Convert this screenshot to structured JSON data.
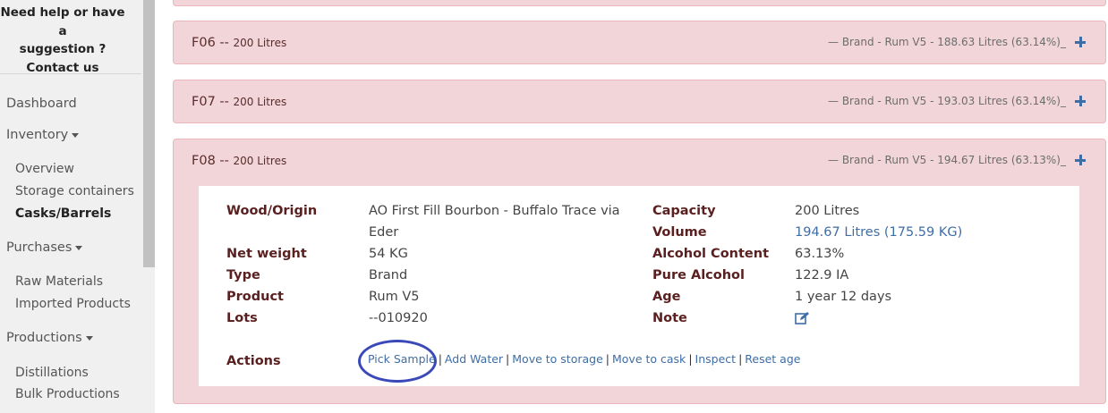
{
  "sidebar": {
    "help_line1": "Need help or have a",
    "help_line2": "suggestion ?",
    "contact": "Contact us",
    "items": [
      {
        "label": "Dashboard"
      },
      {
        "label": "Inventory"
      },
      {
        "label": "Overview"
      },
      {
        "label": "Storage containers"
      },
      {
        "label": "Casks/Barrels"
      },
      {
        "label": "Purchases"
      },
      {
        "label": "Raw Materials"
      },
      {
        "label": "Imported Products"
      },
      {
        "label": "Productions"
      },
      {
        "label": "Distillations"
      },
      {
        "label": "Bulk Productions"
      }
    ]
  },
  "casks": [
    {
      "id": "F06",
      "sep": "-- ",
      "capacity": "200 Litres",
      "summary": "—  Brand - Rum V5 - 188.63 Litres (63.14%)_"
    },
    {
      "id": "F07",
      "sep": "-- ",
      "capacity": "200 Litres",
      "summary": "—  Brand - Rum V5 - 193.03 Litres (63.14%)_"
    },
    {
      "id": "F08",
      "sep": "-- ",
      "capacity": "200 Litres",
      "summary": "—  Brand - Rum V5 - 194.67 Litres (63.13%)_"
    }
  ],
  "detail": {
    "labels": {
      "wood": "Wood/Origin",
      "net_weight": "Net weight",
      "type": "Type",
      "product": "Product",
      "lots": "Lots",
      "capacity": "Capacity",
      "volume": "Volume",
      "alcohol": "Alcohol Content",
      "pure_alcohol": "Pure Alcohol",
      "age": "Age",
      "note": "Note",
      "actions": "Actions"
    },
    "values": {
      "wood_line1": "AO First Fill Bourbon - Buffalo Trace via",
      "wood_line2": "Eder",
      "net_weight": "54 KG",
      "type": "Brand",
      "product": "Rum V5",
      "lots": "--010920",
      "capacity": "200 Litres",
      "volume": "194.67 Litres (175.59 KG)",
      "alcohol": "63.13%",
      "pure_alcohol": "122.9 IA",
      "age": "1 year 12 days"
    },
    "actions": [
      "Pick Sample",
      "Add Water",
      "Move to storage",
      "Move to cask",
      "Inspect",
      "Reset age"
    ],
    "separator": "|"
  },
  "colors": {
    "panel_bg": "#f2d5d8",
    "link": "#3f6da6",
    "highlight_circle": "#3a48b8"
  }
}
